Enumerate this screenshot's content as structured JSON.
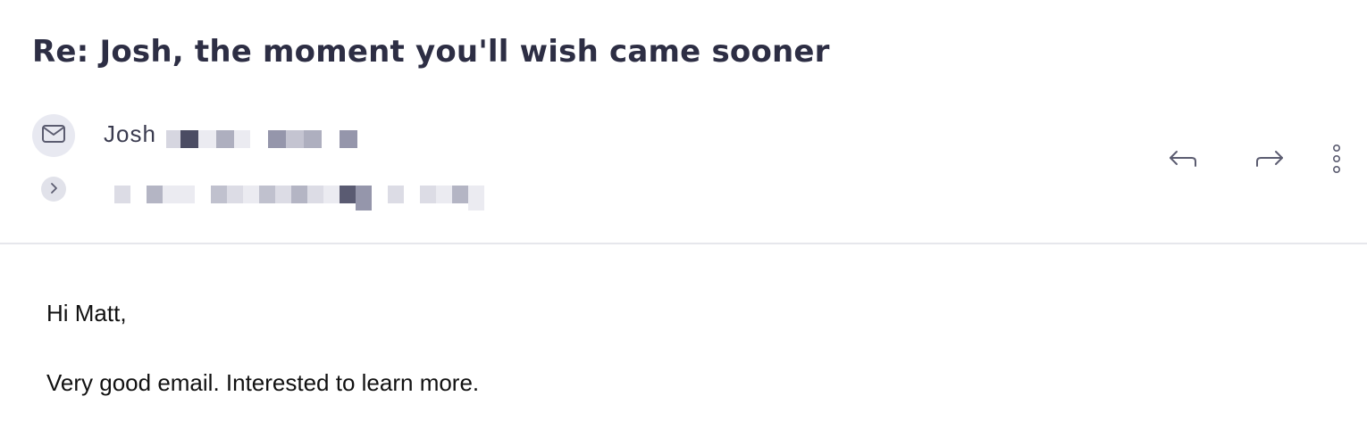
{
  "email": {
    "subject": "Re: Josh, the moment you'll wish came sooner",
    "sender": {
      "name": "Josh",
      "avatar_icon": "envelope-icon"
    },
    "expand_icon": "chevron-right-icon",
    "actions": {
      "reply_icon": "reply-icon",
      "forward_icon": "forward-icon",
      "more_icon": "more-vertical-icon"
    },
    "body": {
      "greeting": "Hi Matt,",
      "line1": "Very good email. Interested to learn more."
    }
  },
  "colors": {
    "subject_text": "#2d2e44",
    "avatar_bg": "#e8e9f1",
    "icon_stroke": "#5b5c70",
    "divider": "#e6e7ec"
  }
}
